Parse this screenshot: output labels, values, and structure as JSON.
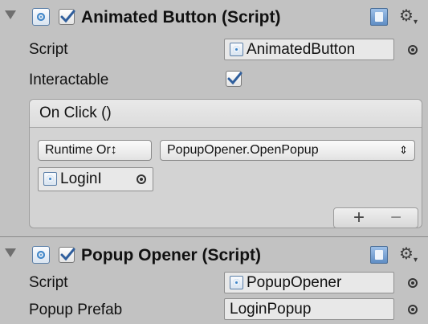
{
  "animated_button": {
    "title": "Animated Button (Script)",
    "enabled": true,
    "rows": {
      "script_label": "Script",
      "script_value": "AnimatedButton",
      "interactable_label": "Interactable",
      "interactable_checked": true
    },
    "on_click": {
      "header": "On Click ()",
      "runtime_dropdown": "Runtime Or↕",
      "function_dropdown": "PopupOpener.OpenPopup",
      "target_object": "LoginI",
      "add_label": "+",
      "remove_label": "−"
    }
  },
  "popup_opener": {
    "title": "Popup Opener (Script)",
    "enabled": true,
    "rows": {
      "script_label": "Script",
      "script_value": "PopupOpener",
      "prefab_label": "Popup Prefab",
      "prefab_value": "LoginPopup"
    }
  },
  "icons": {
    "foldout": "foldout-arrow-icon",
    "script": "csharp-script-icon",
    "help": "help-book-icon",
    "settings": "gear-icon",
    "object_picker": "object-picker-icon"
  },
  "colors": {
    "panel_bg": "#c2c2c2",
    "field_bg": "#e8e8e8",
    "event_bg": "#d3d3d3",
    "checkmark": "#2f5e9c"
  }
}
